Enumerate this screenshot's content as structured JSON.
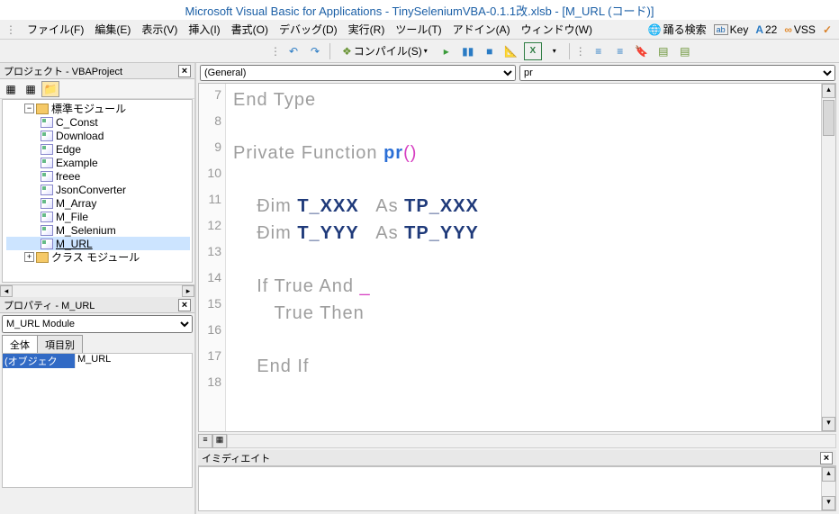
{
  "title": "Microsoft Visual Basic for Applications - TinySeleniumVBA-0.1.1改.xlsb - [M_URL (コード)]",
  "menu": {
    "file": "ファイル(F)",
    "edit": "編集(E)",
    "view": "表示(V)",
    "insert": "挿入(I)",
    "format": "書式(O)",
    "debug": "デバッグ(D)",
    "run": "実行(R)",
    "tools": "ツール(T)",
    "addins": "アドイン(A)",
    "window": "ウィンドウ(W)"
  },
  "menu_right": {
    "search": "踊る検索",
    "key": "Key",
    "num": "22",
    "vss": "VSS"
  },
  "toolbar": {
    "compile": "コンパイル(S)"
  },
  "project": {
    "title": "プロジェクト - VBAProject",
    "folder": "標準モジュール",
    "modules": [
      "C_Const",
      "Download",
      "Edge",
      "Example",
      "freee",
      "JsonConverter",
      "M_Array",
      "M_File",
      "M_Selenium",
      "M_URL"
    ],
    "class_folder": "クラス モジュール"
  },
  "props": {
    "title": "プロパティ - M_URL",
    "combo": "M_URL Module",
    "tab_all": "全体",
    "tab_cat": "項目別",
    "name_key": "(オブジェク",
    "name_val": "M_URL"
  },
  "code": {
    "left_dd": "(General)",
    "right_dd": "pr",
    "lines": [
      7,
      8,
      9,
      10,
      11,
      12,
      13,
      14,
      15,
      16,
      17,
      18
    ],
    "l7": "End Type",
    "l9a": "Private Function ",
    "l9b": "pr",
    "l9c": "()",
    "l11a": "    Đim ",
    "l11b": "T_XXX",
    "l11c": "   As ",
    "l11d": "TP_XXX",
    "l12a": "    Đim ",
    "l12b": "T_YYY",
    "l12c": "   As ",
    "l12d": "TP_YYY",
    "l14": "    If True And ",
    "l14u": "_",
    "l15": "       True Then",
    "l17": "    End If"
  },
  "immediate": {
    "title": "イミディエイト"
  }
}
